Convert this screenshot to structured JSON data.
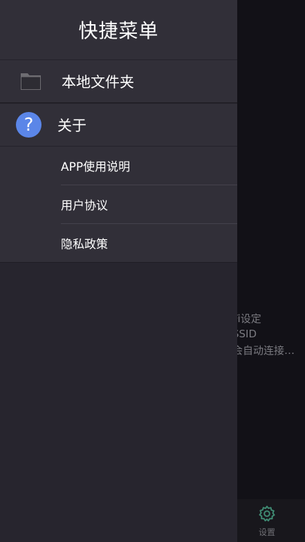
{
  "drawer": {
    "title": "快捷菜单",
    "local_folder": {
      "label": "本地文件夹",
      "icon": "folder-icon"
    },
    "about": {
      "label": "关于",
      "icon": "help-icon",
      "icon_glyph": "?"
    },
    "about_items": [
      {
        "label": "APP使用说明"
      },
      {
        "label": "用户协议"
      },
      {
        "label": "隐私政策"
      }
    ]
  },
  "background": {
    "lines": [
      "Fi设定",
      "SSID",
      "会自动连接…"
    ],
    "bottom_nav": {
      "settings_label": "设置",
      "icon": "gear-icon"
    }
  },
  "colors": {
    "drawer_bg": "#27252e",
    "drawer_item_bg": "#312f38",
    "accent_blue": "#5b86e8",
    "settings_icon_color": "#3f8a72"
  }
}
